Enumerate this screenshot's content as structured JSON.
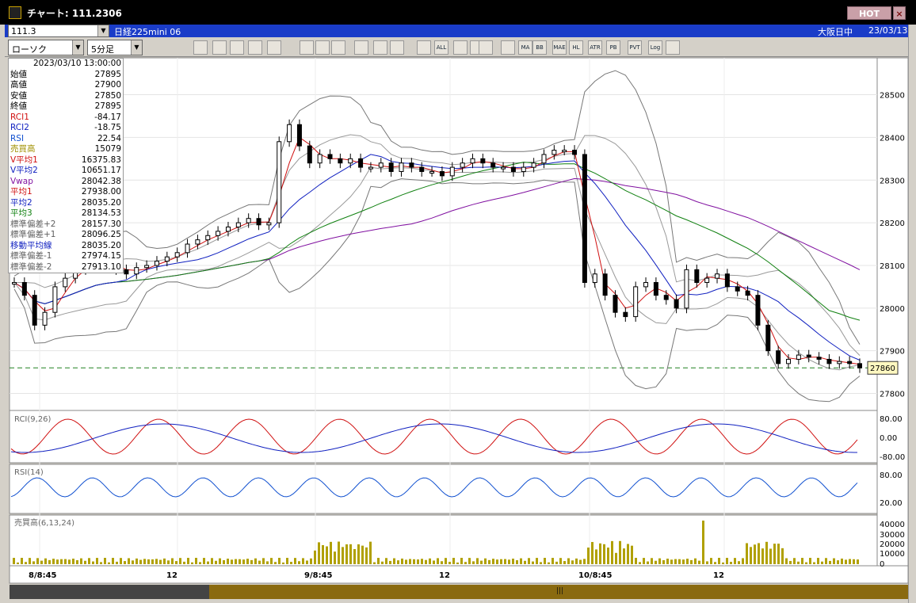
{
  "titlebar": {
    "title": "チャート: 111.2306",
    "hot_label": "HOT",
    "close_label": "×"
  },
  "symbol_bar": {
    "code": "111.3",
    "name": "日経225mini 06",
    "exchange": "大阪日中",
    "date": "23/03/13"
  },
  "toolbar": {
    "chart_type": "ローソク",
    "interval": "5分足",
    "buttons": [
      "zoom-icon",
      "grid-icon",
      "bull-icon",
      "magnify-icon",
      "calc-icon",
      "cross-icon",
      "triangle-icon",
      "pencil-icon",
      "cursor-icon",
      "arrow-icon",
      "candle-a-icon",
      "candle-b-icon",
      "all-icon",
      "chess-icon",
      "brush-icon",
      "color-icon",
      "ichimoku-icon",
      "ma-icon",
      "bb-icon",
      "mae-icon",
      "hl-icon",
      "atr-icon",
      "pb-icon",
      "pvt-icon",
      "log-icon",
      "split-icon"
    ],
    "button_labels": [
      "",
      "",
      "",
      "",
      "",
      "",
      "",
      "",
      "",
      "",
      "",
      "",
      "ALL",
      "",
      "",
      "",
      "",
      "MA",
      "BB",
      "MAE",
      "HL",
      "ATR",
      "PB",
      "PVT",
      "Log",
      ""
    ]
  },
  "info_panel": {
    "datetime": "2023/03/10  13:00:00",
    "rows": [
      {
        "label": "始値",
        "value": "27895",
        "color": "#000000"
      },
      {
        "label": "高値",
        "value": "27900",
        "color": "#000000"
      },
      {
        "label": "安値",
        "value": "27850",
        "color": "#000000"
      },
      {
        "label": "終値",
        "value": "27895",
        "color": "#000000"
      },
      {
        "label": "RCI1",
        "value": "-84.17",
        "color": "#d01010"
      },
      {
        "label": "RCI2",
        "value": "-18.75",
        "color": "#1020c0"
      },
      {
        "label": "RSI",
        "value": "22.54",
        "color": "#1050d0"
      },
      {
        "label": "売買高",
        "value": "15079",
        "color": "#a09000"
      },
      {
        "label": "V平均1",
        "value": "16375.83",
        "color": "#d01010"
      },
      {
        "label": "V平均2",
        "value": "10651.17",
        "color": "#1020c0"
      },
      {
        "label": "Vwap",
        "value": "28042.38",
        "color": "#8010a0"
      },
      {
        "label": "平均1",
        "value": "27938.00",
        "color": "#d01010"
      },
      {
        "label": "平均2",
        "value": "28035.20",
        "color": "#1020c0"
      },
      {
        "label": "平均3",
        "value": "28134.53",
        "color": "#108010"
      },
      {
        "label": "標準偏差+2",
        "value": "28157.30",
        "color": "#606060"
      },
      {
        "label": "標準偏差+1",
        "value": "28096.25",
        "color": "#606060"
      },
      {
        "label": "移動平均線",
        "value": "28035.20",
        "color": "#1020c0"
      },
      {
        "label": "標準偏差-1",
        "value": "27974.15",
        "color": "#606060"
      },
      {
        "label": "標準偏差-2",
        "value": "27913.10",
        "color": "#606060"
      }
    ]
  },
  "chart_data": [
    {
      "type": "candlestick",
      "price_ticks": [
        28500,
        28400,
        28300,
        28200,
        28100,
        28000,
        27900,
        27800
      ],
      "ylim": [
        27775,
        28540
      ],
      "x_labels": [
        "8/8:45",
        "12",
        "9/8:45",
        "12",
        "10/8:45",
        "12"
      ],
      "last_price": "27860",
      "candle_closes": [
        28060,
        28030,
        27960,
        27990,
        28050,
        28070,
        28090,
        28110,
        28120,
        28100,
        28090,
        28080,
        28095,
        28100,
        28110,
        28120,
        28130,
        28150,
        28160,
        28170,
        28180,
        28190,
        28200,
        28210,
        28195,
        28200,
        28390,
        28430,
        28380,
        28340,
        28360,
        28350,
        28340,
        28350,
        28330,
        28330,
        28340,
        28320,
        28340,
        28330,
        28320,
        28320,
        28310,
        28330,
        28340,
        28350,
        28340,
        28330,
        28330,
        28320,
        28330,
        28340,
        28360,
        28370,
        28370,
        28360,
        28060,
        28080,
        28030,
        27990,
        27980,
        28050,
        28060,
        28030,
        28020,
        28000,
        28090,
        28060,
        28070,
        28080,
        28050,
        28040,
        28030,
        27960,
        27900,
        27870,
        27880,
        27890,
        27885,
        27880,
        27870,
        27875,
        27870,
        27860
      ]
    },
    {
      "type": "line",
      "title": "RCI(9,26)",
      "ticks": [
        "80.00",
        "0.00",
        "-80.00"
      ]
    },
    {
      "type": "line",
      "title": "RSI(14)",
      "ticks": [
        "80.00",
        "20.00"
      ]
    },
    {
      "type": "bar",
      "title": "売買高(6,13,24)",
      "ticks": [
        "40000",
        "30000",
        "20000",
        "10000",
        "0"
      ]
    }
  ]
}
